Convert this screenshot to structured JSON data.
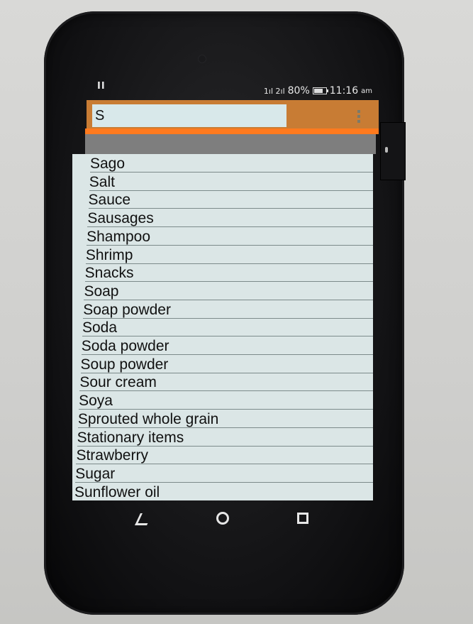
{
  "status_bar": {
    "left_indicator": "II",
    "signal": "1ıl 2ıl",
    "battery_percent": "80%",
    "time": "11:16",
    "ampm": "am"
  },
  "search": {
    "value": "S"
  },
  "suggestions": [
    "Sago",
    "Salt",
    "Sauce",
    "Sausages",
    "Shampoo",
    "Shrimp",
    "Snacks",
    "Soap",
    "Soap powder",
    "Soda",
    "Soda powder",
    "Soup powder",
    "Sour cream",
    "Soya",
    "Sprouted whole grain",
    "Stationary items",
    "Strawberry",
    "Sugar",
    "Sunflower oil"
  ],
  "colors": {
    "toolbar": "#c87c34",
    "accent_rule": "#ff7a1e",
    "list_background": "#dbe6e6"
  },
  "nav_icons": [
    "back-icon",
    "home-icon",
    "recent-apps-icon"
  ]
}
